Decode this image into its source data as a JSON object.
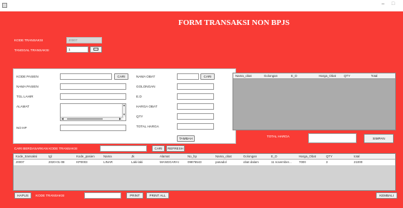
{
  "window": {
    "min_glyph": "–",
    "max_glyph": "□"
  },
  "form": {
    "title": "FORM TRANSAKSI NON BPJS"
  },
  "header": {
    "kode_transaksi_label": "KODE TRANSAKSI",
    "kode_transaksi_value": "J0007",
    "tanggal_label": "TANGGAL TRANSAKSI",
    "tanggal_value": "1"
  },
  "patient": {
    "kode_pasien_label": "KODE PASIEN",
    "cari_label": "CARI",
    "nama_pasien_label": "NAMA PASIEN",
    "tgl_lahir_label": "TGL LAHIR",
    "alamat_label": "ALAMAT",
    "no_hp_label": "NO HP"
  },
  "drug": {
    "nama_obat_label": "NAMA OBAT",
    "cari_label": "CARI",
    "golongan_label": "GOLONGAN",
    "ed_label": "E.D",
    "harga_obat_label": "HARGA OBAT",
    "qty_label": "QTY",
    "total_harga_label": "TOTAL HARGA",
    "tambah_label": "TAMBAH"
  },
  "cart": {
    "columns": [
      "Nama_obat",
      "Golongan",
      "E_D",
      "Harga_Obat",
      "QTY",
      "Total"
    ],
    "total_harga_label": "TOTAL HARGA",
    "simpan_label": "SIMPAN"
  },
  "search": {
    "label": "CARI BERDASARKAN KODE TRANSAKSI",
    "cari_label": "CARI",
    "refresh_label": "REFRESH"
  },
  "table": {
    "columns": [
      "Kode_transaksi",
      "tgl",
      "Kode_pasien",
      "Nama",
      "Jk",
      "Alamat",
      "No_hp",
      "Nama_obat",
      "Golongan",
      "E_D",
      "Harga_Obat",
      "QTY",
      "total"
    ],
    "rows": [
      [
        "J0007",
        "2020-01-08",
        "KP0003",
        "LINAR",
        "Laki-laki",
        "MANGGARAI",
        "09875543",
        "panadol",
        "obat dalam",
        "11 november...",
        "7000",
        "3",
        "21000"
      ]
    ]
  },
  "footer": {
    "hapus_label": "HAPUS",
    "kode_transaksi_label": "KODE TRANSAKSI",
    "print_label": "PRINT",
    "print_all_label": "PRINT ALL",
    "kembali_label": "KEMBALI"
  },
  "colors": {
    "form_bg": "#f93b35",
    "cart_bg": "#ababab",
    "table_bg": "#d2d2d2"
  }
}
